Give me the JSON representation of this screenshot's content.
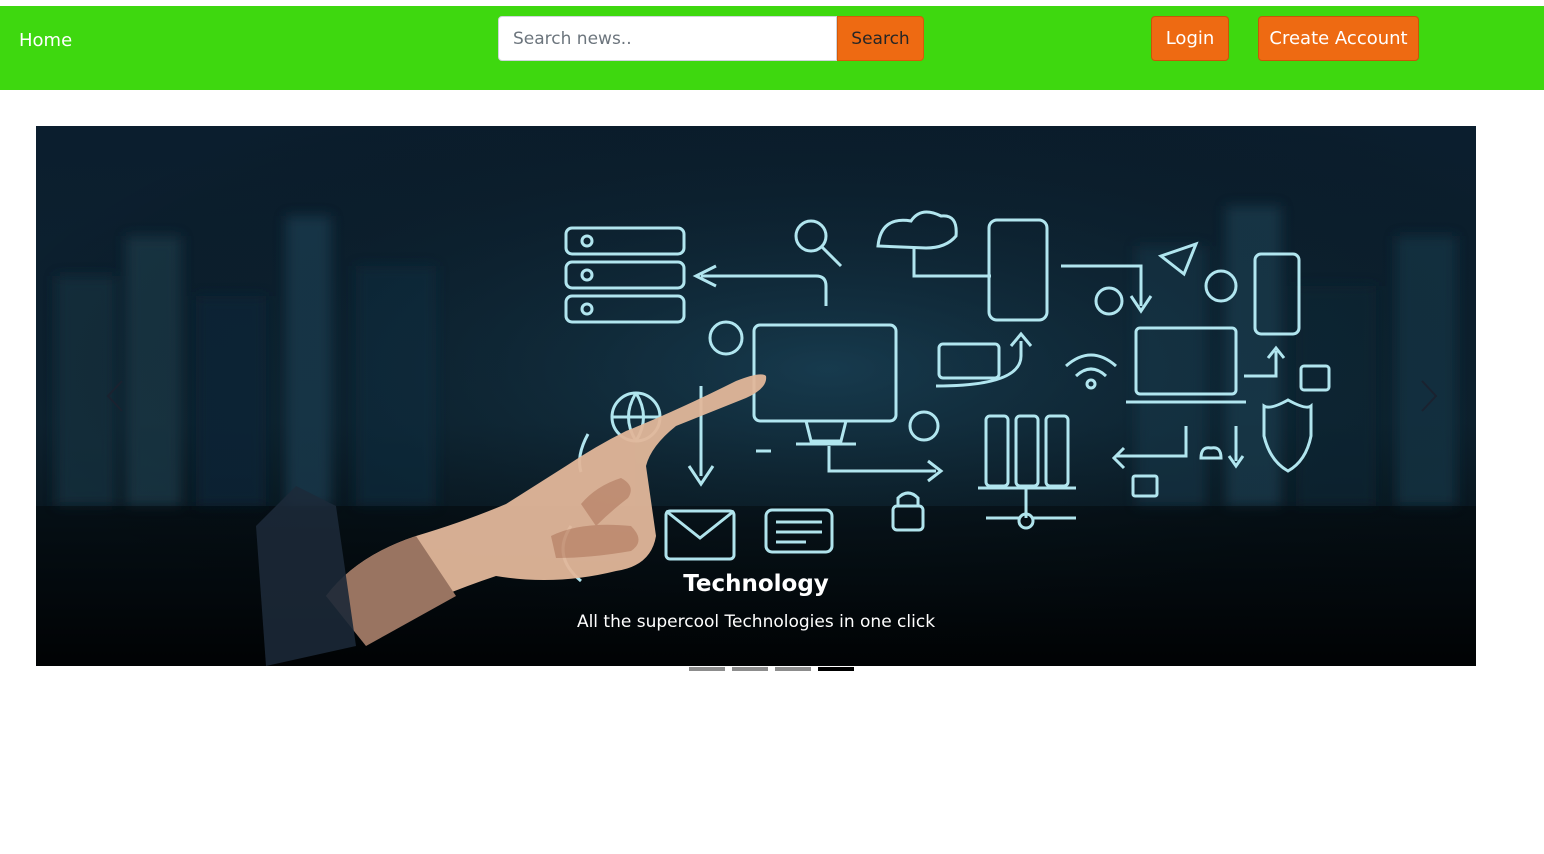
{
  "nav": {
    "home_label": "Home",
    "search_placeholder": "Search news..",
    "search_button": "Search",
    "login_button": "Login",
    "create_account_button": "Create Account",
    "colors": {
      "navbar": "#3ed80f",
      "button": "#ee6a12"
    }
  },
  "carousel": {
    "slide": {
      "title": "Technology",
      "text": "All the supercool Technologies in one click"
    },
    "indicators": [
      {
        "active": false
      },
      {
        "active": false
      },
      {
        "active": false
      },
      {
        "active": true
      }
    ],
    "icons": [
      "chevron-left-icon",
      "chevron-right-icon"
    ]
  }
}
